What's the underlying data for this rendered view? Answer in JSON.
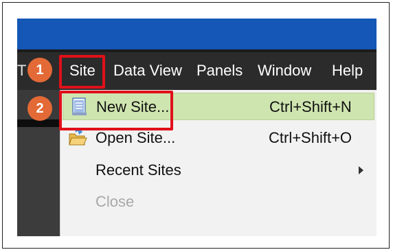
{
  "menubar": {
    "partial_left": "T",
    "items": [
      "Site",
      "Data View",
      "Panels",
      "Window",
      "Help"
    ]
  },
  "site_menu": {
    "items": [
      {
        "label": "New Site...",
        "shortcut": "Ctrl+Shift+N",
        "icon": "new-document-icon",
        "state": "highlighted"
      },
      {
        "label": "Open Site...",
        "shortcut": "Ctrl+Shift+O",
        "icon": "open-folder-icon",
        "state": "normal"
      },
      {
        "label": "Recent Sites",
        "shortcut": "",
        "icon": "",
        "state": "submenu"
      },
      {
        "label": "Close",
        "shortcut": "",
        "icon": "",
        "state": "disabled"
      }
    ]
  },
  "annotations": {
    "steps": [
      "1",
      "2"
    ],
    "highlight_color": "#e0101a",
    "badge_color": "#e36a37"
  },
  "colors": {
    "titlebar": "#1457b6",
    "menubar": "#2b2b2b",
    "menu_highlight": "#cfe5b0"
  }
}
